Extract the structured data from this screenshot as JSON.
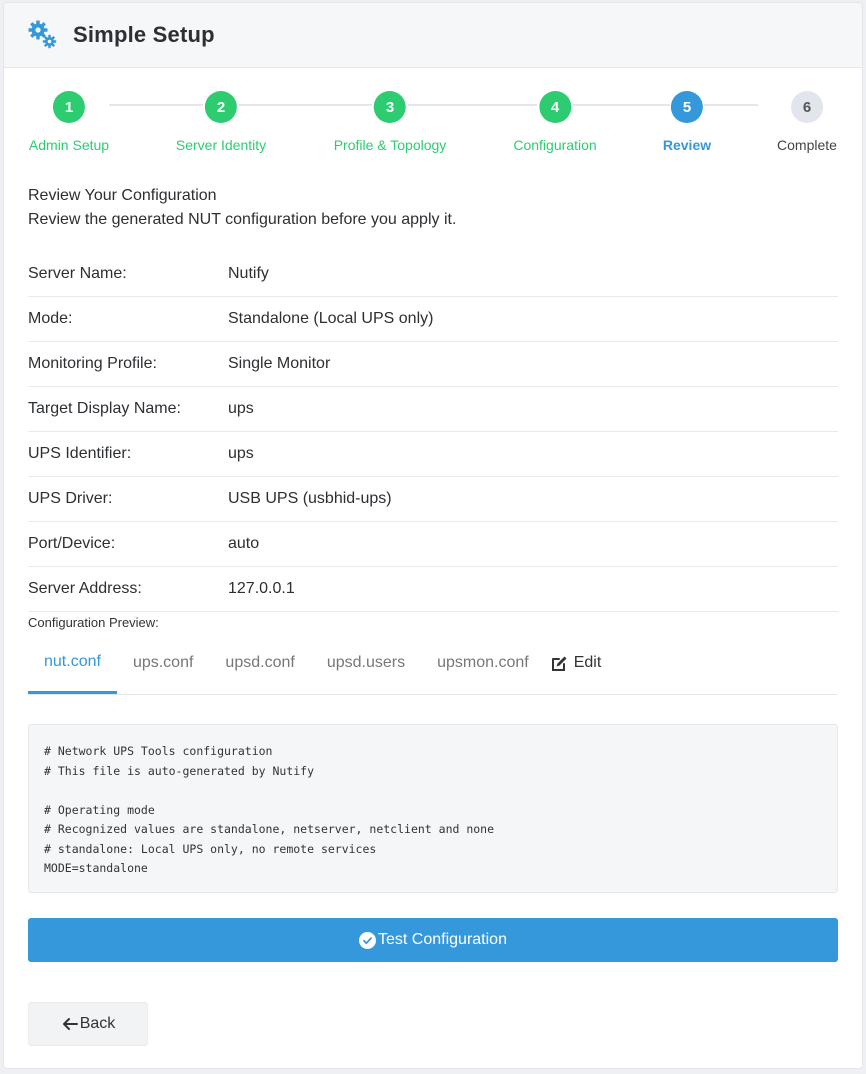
{
  "header": {
    "title": "Simple Setup",
    "icon": "gears-icon"
  },
  "steps": [
    {
      "num": "1",
      "label": "Admin Setup",
      "state": "done"
    },
    {
      "num": "2",
      "label": "Server Identity",
      "state": "done"
    },
    {
      "num": "3",
      "label": "Profile & Topology",
      "state": "done"
    },
    {
      "num": "4",
      "label": "Configuration",
      "state": "done"
    },
    {
      "num": "5",
      "label": "Review",
      "state": "active"
    },
    {
      "num": "6",
      "label": "Complete",
      "state": "pending"
    }
  ],
  "intro": {
    "title": "Review Your Configuration",
    "description": "Review the generated NUT configuration before you apply it."
  },
  "summary": [
    {
      "key": "Server Name:",
      "value": "Nutify"
    },
    {
      "key": "Mode:",
      "value": "Standalone (Local UPS only)"
    },
    {
      "key": "Monitoring Profile:",
      "value": "Single Monitor"
    },
    {
      "key": "Target Display Name:",
      "value": "ups"
    },
    {
      "key": "UPS Identifier:",
      "value": "ups"
    },
    {
      "key": "UPS Driver:",
      "value": "USB UPS (usbhid-ups)"
    },
    {
      "key": "Port/Device:",
      "value": "auto"
    },
    {
      "key": "Server Address:",
      "value": "127.0.0.1"
    }
  ],
  "preview": {
    "label": "Configuration Preview:",
    "tabs": [
      "nut.conf",
      "ups.conf",
      "upsd.conf",
      "upsd.users",
      "upsmon.conf"
    ],
    "active_tab": "nut.conf",
    "edit_label": "Edit",
    "code": "# Network UPS Tools configuration\n# This file is auto-generated by Nutify\n\n# Operating mode\n# Recognized values are standalone, netserver, netclient and none\n# standalone: Local UPS only, no remote services\nMODE=standalone"
  },
  "buttons": {
    "test": "Test Configuration",
    "back": "Back"
  },
  "colors": {
    "done": "#2ecc71",
    "active": "#3498db",
    "pending": "#e2e6ec"
  }
}
